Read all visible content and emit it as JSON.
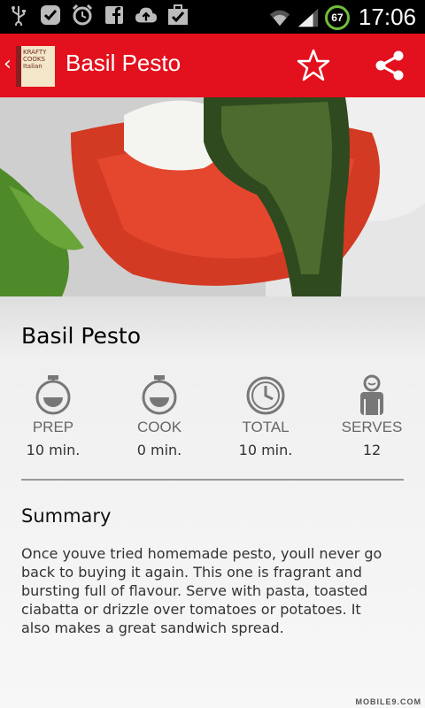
{
  "status_bar": {
    "icons": [
      "usb-icon",
      "check-icon",
      "alarm-icon",
      "facebook-icon",
      "cloud-upload-icon",
      "briefcase-check-icon",
      "wifi-icon",
      "signal-icon"
    ],
    "battery": "67",
    "time": "17:06"
  },
  "action_bar": {
    "app_icon_text": "KRAFTY COOKS Italian",
    "title": "Basil Pesto",
    "color": "#e3101d"
  },
  "recipe": {
    "title": "Basil Pesto",
    "stats": [
      {
        "label": "PREP",
        "value": "10 min.",
        "icon": "timer-icon"
      },
      {
        "label": "COOK",
        "value": "0 min.",
        "icon": "timer-icon"
      },
      {
        "label": "TOTAL",
        "value": "10 min.",
        "icon": "clock-icon"
      },
      {
        "label": "SERVES",
        "value": "12",
        "icon": "person-icon"
      }
    ],
    "summary_heading": "Summary",
    "summary": "Once youve tried homemade pesto, youll never go back to buying it again. This one is fragrant and bursting full of flavour. Serve with pasta, toasted ciabatta or drizzle over tomatoes or potatoes. It also makes a great sandwich spread."
  },
  "watermark": "MOBILE9.COM"
}
